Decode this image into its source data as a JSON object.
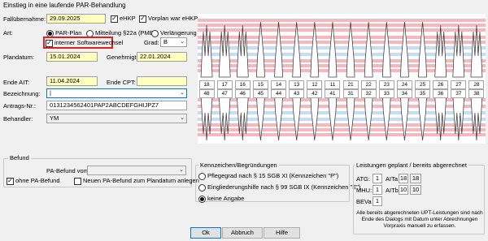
{
  "window": {
    "title": "Einstieg in eine laufende PAR-Behandlung"
  },
  "form": {
    "fallubernahme_label": "Fallübernahme:",
    "fallubernahme_value": "29.09.2025",
    "ehkp_label": "eHKP",
    "ehkp_checked": true,
    "vorplan_label": "Vorplan war eHKP",
    "vorplan_checked": true,
    "art_label": "Art:",
    "art_options": [
      "PAR-Plan",
      "Mitteilung §22a (PMB)",
      "Verlängerung"
    ],
    "art_selected": "PAR-Plan",
    "interner_label": "interner Softwarewechsel",
    "interner_checked": true,
    "grad_label": "Grad:",
    "grad_value": "B",
    "plandatum_label": "Plandatum:",
    "plandatum_value": "15.01.2024",
    "genehmigt_label": "Genehmigt:",
    "genehmigt_value": "22.01.2024",
    "ende_ait_label": "Ende AIT:",
    "ende_ait_value": "11.04.2024",
    "ende_cpt_label": "Ende CPT:",
    "ende_cpt_value": "",
    "bezeichnung_label": "Bezeichnung:",
    "bezeichnung_value": "|",
    "antrags_label": "Antrags-Nr.:",
    "antrags_value": "0131234562401PAP2ABCDEFGHIJPZ7",
    "behandler_label": "Behandler:",
    "behandler_value": "YM"
  },
  "teeth": {
    "upper": [
      "18",
      "17",
      "16",
      "15",
      "14",
      "13",
      "12",
      "11",
      "21",
      "22",
      "23",
      "24",
      "25",
      "26",
      "27",
      "28"
    ],
    "lower": [
      "48",
      "47",
      "46",
      "45",
      "44",
      "43",
      "42",
      "41",
      "31",
      "32",
      "33",
      "34",
      "35",
      "36",
      "37",
      "38"
    ]
  },
  "befund": {
    "title": "Befund",
    "pa_befund_label": "PA-Befund vom:",
    "pa_befund_value": "",
    "ohne_label": "ohne PA-Befund",
    "ohne_checked": true,
    "neuen_label": "Neuen PA-Befund zum Plandatum anlegen",
    "neuen_checked": false
  },
  "kennzeichen": {
    "title": "Kennzeichen/Begründungen",
    "options": [
      "Pflegegrad nach § 15 SGB XI (Kennzeichen \"P\")",
      "Eingliederungshilfe nach § 99 SGB IX (Kennzeichen \"E\")",
      "keine Angabe"
    ],
    "selected": "keine Angabe"
  },
  "leistungen": {
    "title": "Leistungen geplant / bereits abgerechnet",
    "atg_label": "ATG:",
    "atg_planned": "1",
    "alta_label": "AITa",
    "alta_value": "18",
    "alta_done": "18",
    "mhu_label": "MHU:",
    "mhu_planned": "1",
    "altb_label": "AITb",
    "altb_value": "10",
    "altb_done": "10",
    "beva_label": "BEVa",
    "beva_planned": "1",
    "note": "Alle bereits abgerechneten UPT-Leistungen sind nach Ende des Dialogs mit Datum unter Abrechnungen Vorpraxis manuell zu erfassen."
  },
  "buttons": {
    "ok": "Ok",
    "abbruch": "Abbruch",
    "hilfe": "Hilfe"
  },
  "colors": {
    "highlight_yellow": "#ffffc0",
    "red_frame": "#e02020",
    "stripe_red": "#f3b9bf",
    "stripe_blue": "#c7dcf5"
  }
}
